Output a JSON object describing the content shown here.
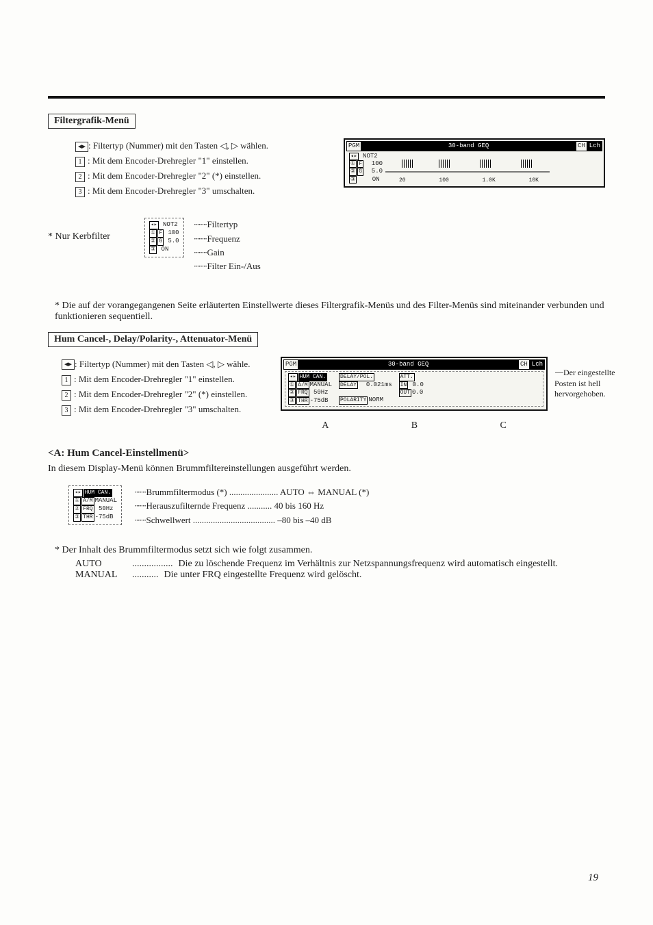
{
  "page_number": "19",
  "sect1_title": "Filtergrafik-Menü",
  "sect1_lines": {
    "l1_pre": ": Filtertyp (Nummer) mit den Tasten ◁, ▷ wählen.",
    "l2": ": Mit dem Encoder-Drehregler \"1\" einstellen.",
    "l3": ": Mit dem Encoder-Drehregler \"2\" (*) einstellen.",
    "l4": ": Mit dem Encoder-Drehregler \"3\" umschalten."
  },
  "sect1_labels": {
    "filtertyp": "Filtertyp",
    "frequenz": "Frequenz",
    "gain": "Gain",
    "filter_onoff": "Filter Ein-/Aus"
  },
  "lcd1": {
    "head_pgm": "PGM",
    "head_title": "30-band GEQ",
    "head_ch": "CH",
    "head_lch": "Lch",
    "p_arrow": "◂▸",
    "p_1F": "① F",
    "p_2G": "② G",
    "p_3": "③",
    "not2": "NOT2",
    "v100": "100",
    "v50": "5.0",
    "von": "ON",
    "axis_20": "20",
    "axis_100": "100",
    "axis_1k": "1.0K",
    "axis_10k": "10K"
  },
  "nur_kerbfilter": "Nur Kerbfilter",
  "sect1_note": "Die auf der vorangegangenen Seite erläuterten Einstellwerte dieses Filtergrafik-Menüs und des Filter-Menüs sind miteinander verbunden und funktionieren sequentiell.",
  "sect2_title": "Hum Cancel-, Delay/Polarity-, Attenuator-Menü",
  "sect2_lines": {
    "l1": ": Filtertyp (Nummer) mit den Tasten ◁, ▷ wähle.",
    "l2": ": Mit dem Encoder-Drehregler \"1\" einstellen.",
    "l3": ": Mit dem Encoder-Drehregler \"2\" (*) einstellen.",
    "l4": ": Mit dem Encoder-Drehregler \"3\" umschalten."
  },
  "lcd2": {
    "head_pgm": "PGM",
    "head_title": "30-band GEQ",
    "head_ch": "CH",
    "head_lch": "Lch",
    "hum": "HUM CAN.",
    "delaypol": "DELAY/POL.",
    "att": "ATT.",
    "am": "A/M",
    "manual": "MANUAL",
    "frq": "FRQ",
    "thr": "THR",
    "v50hz": "50Hz",
    "v75db": "-75dB",
    "delay": "DELAY",
    "delay_val": "0.021ms",
    "polarity": "POLARITY",
    "pol_val": "NORM",
    "in": "IN",
    "out": "OUT",
    "v00a": "0.0",
    "v00b": "0.0",
    "colA": "A",
    "colB": "B",
    "colC": "C"
  },
  "side_note": "Der eingestellte Posten ist hell hervorgehoben.",
  "subA_title": "<A: Hum Cancel-Einstellmenü>",
  "subA_desc": "In diesem Display-Menü können Brummfiltereinstellungen ausgeführt werden.",
  "subA_rows": {
    "r1_label": "Brummfiltermodus (*)",
    "r1_val": "AUTO ⇔ MANUAL (*)",
    "r2_label": "Herauszufilternde Frequenz",
    "r2_val": "40 bis 160 Hz",
    "r3_label": "Schwellwert",
    "r3_val": "–80 bis –40 dB"
  },
  "subA_lcd": {
    "hum": "HUM CAN.",
    "am": "A/M",
    "manual": "MANUAL",
    "frq": "FRQ",
    "v50": "50Hz",
    "thr": "THR",
    "v75": "-75dB"
  },
  "subA_note_lead": "Der Inhalt des Brummfiltermodus setzt sich wie folgt zusammen.",
  "subA_modes": {
    "auto_label": "AUTO",
    "auto_dots": ".................",
    "auto_desc": "Die zu löschende Frequenz im Verhältnis zur Netzspannungsfrequenz wird automatisch eingestellt.",
    "man_label": "MANUAL",
    "man_dots": "...........",
    "man_desc": "Die unter FRQ eingestellte Frequenz wird gelöscht."
  }
}
